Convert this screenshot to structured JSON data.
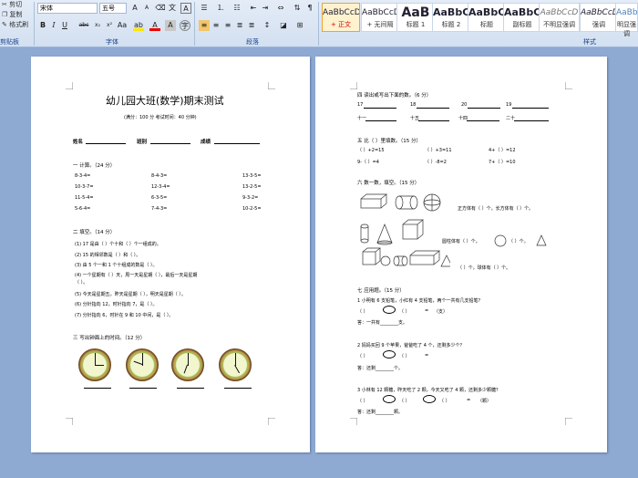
{
  "ribbon": {
    "clipboard": {
      "cut": "剪切",
      "copy": "复制",
      "format_painter": "格式刷",
      "group_label": "剪贴板"
    },
    "font": {
      "name": "宋体",
      "size": "五号",
      "group_label": "字体"
    },
    "paragraph": {
      "group_label": "段落"
    },
    "styles": {
      "group_label": "样式",
      "items": [
        {
          "sample": "AaBbCcD",
          "label": "+ 正文"
        },
        {
          "sample": "AaBbCcD",
          "label": "+ 无间隔"
        },
        {
          "sample": "AaB",
          "label": "标题 1"
        },
        {
          "sample": "AaBbC",
          "label": "标题 2"
        },
        {
          "sample": "AaBbC",
          "label": "标题"
        },
        {
          "sample": "AaBbC",
          "label": "副标题"
        },
        {
          "sample": "AaBbCcD",
          "label": "不明显强调"
        },
        {
          "sample": "AaBbCcD",
          "label": "强调"
        },
        {
          "sample": "AaBbCcD",
          "label": "明显强调"
        }
      ]
    }
  },
  "page1": {
    "title": "幼儿园大班(数学)期末测试",
    "subtitle": "(满分：100 分    考试时间：40 分钟)",
    "name": "姓名",
    "class": "班别",
    "score": "成绩",
    "s1": "一  计算。（24 分）",
    "calc": [
      [
        "8-3-4=",
        "8-4-3=",
        "13-3-5="
      ],
      [
        "10-3-7=",
        "12-3-4=",
        "13-2-5="
      ],
      [
        "11-5-4=",
        "6-3-5=",
        "9-3-2="
      ],
      [
        "5-6-4=",
        "7-4-3=",
        "10-2-5="
      ]
    ],
    "s2": "二  填空。（14 分）",
    "fill": [
      "(1)    17 是由（      ）个十和（      ）个一组成的。",
      "(2)    15 的相邻数是（        ）和（        ）。",
      "(3)    由 5 个一和 1 个十组成的数是（        ）。",
      "(4)    一个星期有（      ）天，周一天是星期（      ），最后一天是星期",
      "           （      ）。",
      "(5)    今天是星期五，昨天是星期（      ），明天是星期（      ）。",
      "(6)    分针指向 12，时针指向 7，是（                  ）。",
      "(7)    分针指向 6，时针在 9 和 10 中间，是（                ）。"
    ],
    "s3": "三  写出钟面上的时间。（12 分）"
  },
  "page2": {
    "s4": "四  读出或写出下面的数。（6 分）",
    "nums": [
      "17",
      "18",
      "20",
      "19",
      "十一",
      "十五",
      "十四",
      "二十"
    ],
    "s5": "五  比（  ）里填数。（15 分）",
    "cmp": [
      [
        "（      ）+2=15",
        "（      ）+3=11",
        "4+（      ）=12"
      ],
      [
        "9-（      ）=4",
        "（      ）-8=2",
        "7+（      ）=10"
      ]
    ],
    "s6": "六  数一数，填空。（15 分）",
    "shapes_text": [
      "正方体有（      ）个，长方体有（      ）个。",
      "圆柱体有（      ）个，",
      "（      ）个。",
      "（      ）个，球体有（      ）个。"
    ],
    "s7": "七  应用题。（15 分）",
    "q1": "1 小明有 6 支铅笔，小红有 4 支铅笔，两个一共有几支铅笔？",
    "q1_ans": "答：一共有________支。",
    "q2": "2 妈妈买回 9 个苹果，爸爸吃了 4 个，还剩多少个？",
    "q2_ans": "答：还剩________个。",
    "q3": "3 小林有 12 颗糖，昨天吃了 2 颗，今天又吃了 4 颗，还剩多少颗糖？",
    "q3_ans": "答：还剩________颗。",
    "op": [
      "（      ）",
      "（      ）",
      "（      ）",
      "（颗）"
    ],
    "unit1": "（支）"
  }
}
